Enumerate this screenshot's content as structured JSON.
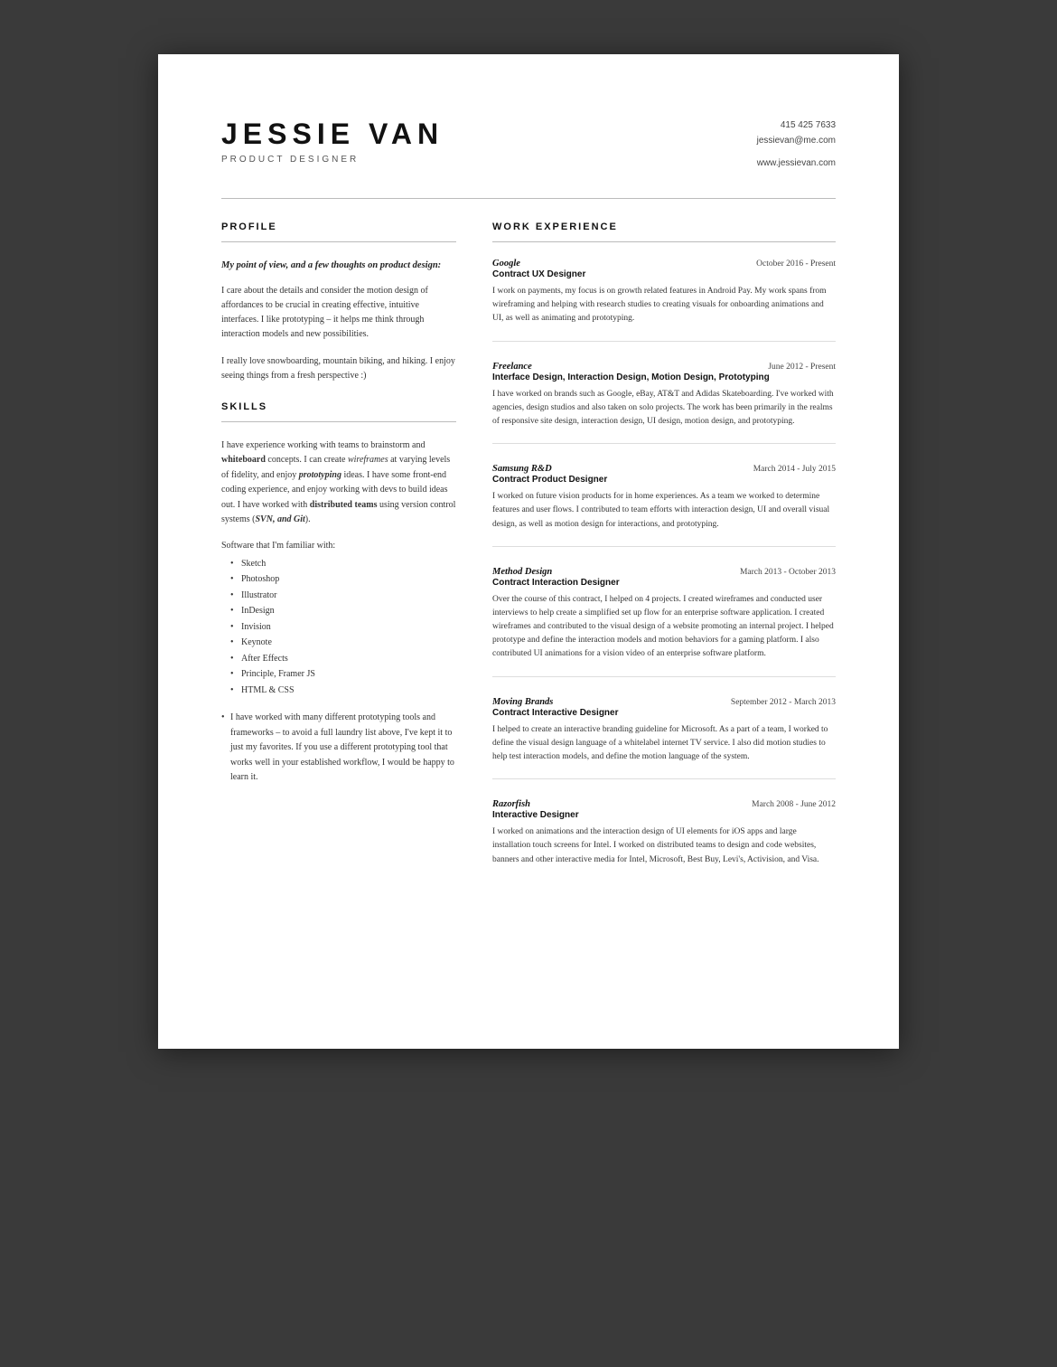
{
  "header": {
    "name": "JESSIE VAN",
    "title": "PRODUCT DESIGNER",
    "phone": "415 425 7633",
    "email": "jessievan@me.com",
    "website": "www.jessievan.com"
  },
  "profile": {
    "section_title": "PROFILE",
    "intro_line1": "My point of view, and a few",
    "intro_line2": "thoughts on product design:",
    "paragraph1": "I care about the details and consider the motion design of affordances to be crucial in creating effective, intuitive interfaces. I like prototyping – it helps me think through interaction models and new possibilities.",
    "paragraph2": "I really love snowboarding, mountain biking, and hiking. I enjoy seeing things from a fresh perspective :)"
  },
  "skills": {
    "section_title": "SKILLS",
    "paragraph": "I have experience working with teams to brainstorm and whiteboard concepts. I can create wireframes at varying levels of fidelity, and enjoy prototyping ideas. I have some front-end coding experience, and enjoy working with devs to build ideas out. I have worked with distributed teams using version control systems (SVN, and Git).",
    "software_heading": "Software that I'm familiar with:",
    "software_list": [
      "Sketch",
      "Photoshop",
      "Illustrator",
      "InDesign",
      "Invision",
      "Keynote",
      "After Effects",
      "Principle, Framer JS",
      "HTML & CSS"
    ],
    "note": "I have worked with many different prototyping tools and frameworks – to avoid a full laundry list above, I've kept it to just my favorites. If you use a different prototyping tool that works well in your established workflow, I would be happy to learn it."
  },
  "work_experience": {
    "section_title": "WORK EXPERIENCE",
    "jobs": [
      {
        "company": "Google",
        "dates": "October 2016 - Present",
        "title": "Contract UX Designer",
        "description": "I work on payments, my focus is on growth related features in Android Pay. My work spans from wireframing and helping with research studies to creating visuals for onboarding animations and UI, as well as animating and prototyping."
      },
      {
        "company": "Freelance",
        "dates": "June 2012 - Present",
        "title": "Interface Design, Interaction Design,  Motion Design, Prototyping",
        "description": "I have worked on brands such as Google, eBay, AT&T and Adidas Skateboarding. I've worked with agencies, design studios and also taken on solo projects. The work has been primarily in the realms of responsive site design, interaction design, UI design, motion design, and prototyping."
      },
      {
        "company": "Samsung R&D",
        "dates": "March 2014 - July 2015",
        "title": "Contract Product Designer",
        "description": "I worked on future vision products for in home experiences.  As a team we worked to determine features and user flows.  I contributed to team efforts with interaction design, UI and overall visual design, as well as motion design for interactions, and prototyping."
      },
      {
        "company": "Method Design",
        "dates": "March 2013 - October 2013",
        "title": "Contract Interaction Designer",
        "description": "Over the course of this contract, I helped on 4 projects. I created wireframes and conducted user interviews to help create a simplified set up flow for an enterprise software application. I created wireframes and contributed to the visual design of a website promoting an internal project. I helped prototype and define the interaction models and motion behaviors for a gaming platform. I also contributed UI animations for a vision video of an enterprise software platform."
      },
      {
        "company": "Moving Brands",
        "dates": "September 2012 - March  2013",
        "title": "Contract Interactive Designer",
        "description": "I helped to create an interactive branding guideline for Microsoft. As a part of a team, I worked to define the visual design language of a whitelabel internet TV service. I also did motion studies  to help test interaction models, and define the motion language of the system."
      },
      {
        "company": "Razorfish",
        "dates": "March 2008 - June  2012",
        "title": "Interactive Designer",
        "description": "I worked on animations and the interaction design of UI elements for iOS apps and large installation touch screens for Intel. I worked on distributed teams to design and code websites, banners and other interactive media for Intel, Microsoft, Best Buy, Levi's, Activision, and Visa."
      }
    ]
  }
}
